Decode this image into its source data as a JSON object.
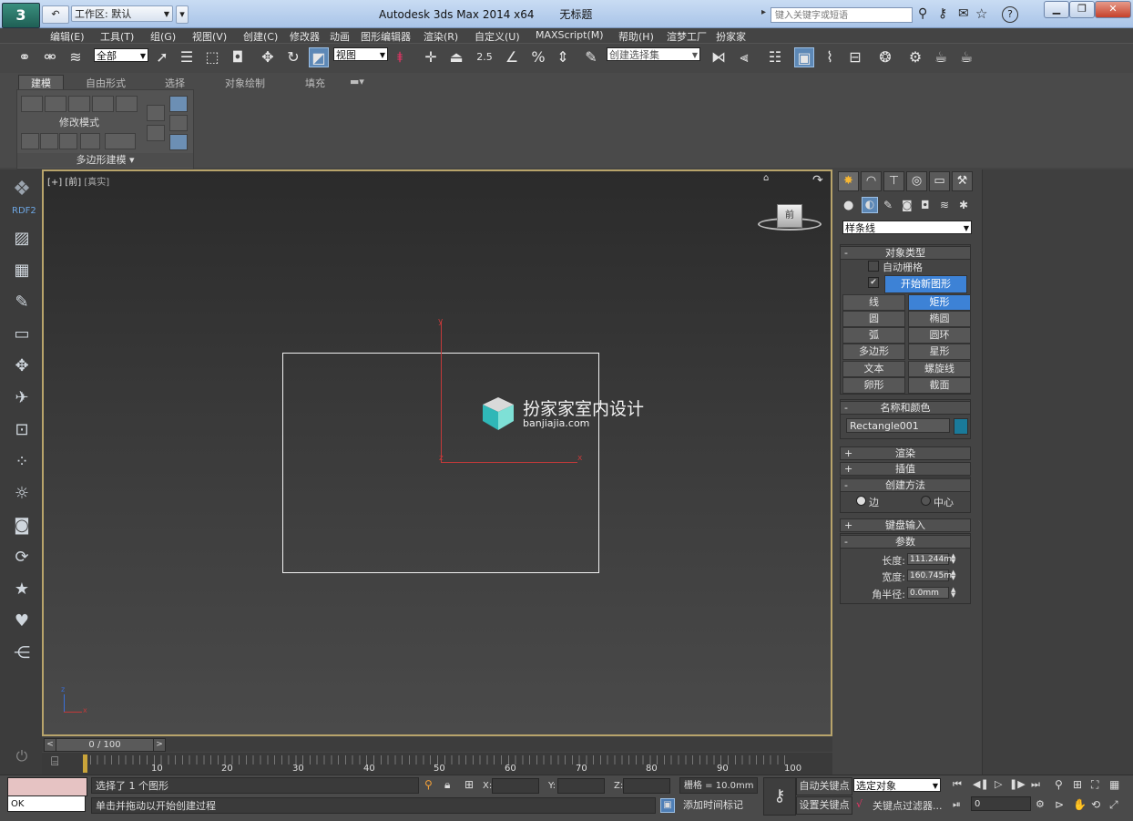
{
  "titlebar": {
    "workspace_label": "工作区: 默认",
    "title": "Autodesk 3ds Max  2014 x64",
    "doc_name": "无标题",
    "search_placeholder": "键入关键字或短语",
    "help_label": "?"
  },
  "menu": [
    "编辑(E)",
    "工具(T)",
    "组(G)",
    "视图(V)",
    "创建(C)",
    "修改器",
    "动画",
    "图形编辑器",
    "渲染(R)",
    "自定义(U)",
    "MAXScript(M)",
    "帮助(H)",
    "渲梦工厂",
    "扮家家"
  ],
  "toolbar": {
    "selection_filter": "全部",
    "ref_coord": "视图",
    "named_selection": "创建选择集",
    "snap_angle_label": "2.5"
  },
  "ribbon": {
    "tabs": [
      "建模",
      "自由形式",
      "选择",
      "对象绘制",
      "填充"
    ],
    "panel_label": "修改模式",
    "panel_footer": "多边形建模"
  },
  "leftbar": {
    "rdf_label": "RDF2"
  },
  "viewport": {
    "label_plus": "[+]",
    "label_view": "[前]",
    "label_shading": "[真实]",
    "viewcube_face": "前",
    "axis_y": "y",
    "axis_x": "x",
    "axis_z": "z",
    "watermark_title": "扮家家室内设计",
    "watermark_url": "banjiajia.com"
  },
  "command_panel": {
    "category": "样条线",
    "object_type": {
      "title": "对象类型",
      "auto_grid": "自动栅格",
      "start_new_shape": "开始新图形",
      "start_new_shape_checked": true,
      "buttons": [
        "线",
        "矩形",
        "圆",
        "椭圆",
        "弧",
        "圆环",
        "多边形",
        "星形",
        "文本",
        "螺旋线",
        "卵形",
        "截面"
      ],
      "active": "矩形"
    },
    "name_color": {
      "title": "名称和颜色",
      "name": "Rectangle001",
      "color": "#1a7a9a"
    },
    "rollouts_collapsed": [
      "渲染",
      "插值"
    ],
    "creation_method": {
      "title": "创建方法",
      "options": [
        "边",
        "中心"
      ],
      "selected": "边"
    },
    "keyboard_entry": "键盘输入",
    "parameters": {
      "title": "参数",
      "length_label": "长度:",
      "length": "111.244m",
      "width_label": "宽度:",
      "width": "160.745m",
      "corner_label": "角半径:",
      "corner": "0.0mm"
    }
  },
  "timeline": {
    "frame_display": "0 / 100",
    "ticks": [
      "10",
      "20",
      "30",
      "40",
      "50",
      "60",
      "70",
      "80",
      "90",
      "100"
    ]
  },
  "status": {
    "script_output": "OK",
    "selection_info": "选择了 1 个图形",
    "prompt": "单击并拖动以开始创建过程",
    "x_label": "X:",
    "y_label": "Y:",
    "z_label": "Z:",
    "grid": "栅格 = 10.0mm",
    "add_time_tag": "添加时间标记",
    "auto_key": "自动关键点",
    "set_key": "设置关键点",
    "key_target": "选定对象",
    "key_filters": "关键点过滤器...",
    "current_frame": "0"
  }
}
